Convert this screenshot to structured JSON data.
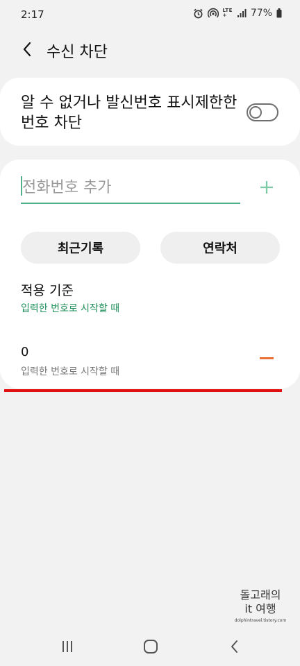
{
  "status_bar": {
    "time": "2:17",
    "lte_line1": "LTE",
    "lte_line2": "+",
    "battery": "77%"
  },
  "header": {
    "title": "수신 차단"
  },
  "unknown_block": {
    "label": "알 수 없거나 발신번호 표시제한한 번호 차단",
    "enabled": false
  },
  "add_number": {
    "placeholder": "전화번호 추가"
  },
  "buttons": {
    "recent": "최근기록",
    "contacts": "연락처"
  },
  "criteria": {
    "title": "적용 기준",
    "value": "입력한 번호로 시작할 때"
  },
  "blocked_list": [
    {
      "number": "0",
      "condition": "입력한 번호로 시작할 때"
    }
  ],
  "watermark": {
    "line1": "돌고래의",
    "line2": "it 여행",
    "url": "dolphintravel.tistory.com"
  },
  "colors": {
    "accent_green": "#4fb08a",
    "accent_text": "#1f8f5a",
    "remove_orange": "#e8601c",
    "annotation_red": "#e01010"
  },
  "icons": [
    "alarm-icon",
    "hotspot-icon",
    "signal-icon",
    "battery-icon",
    "back-arrow-icon",
    "plus-icon",
    "minus-icon",
    "nav-recent-icon",
    "nav-home-icon",
    "nav-back-icon"
  ]
}
